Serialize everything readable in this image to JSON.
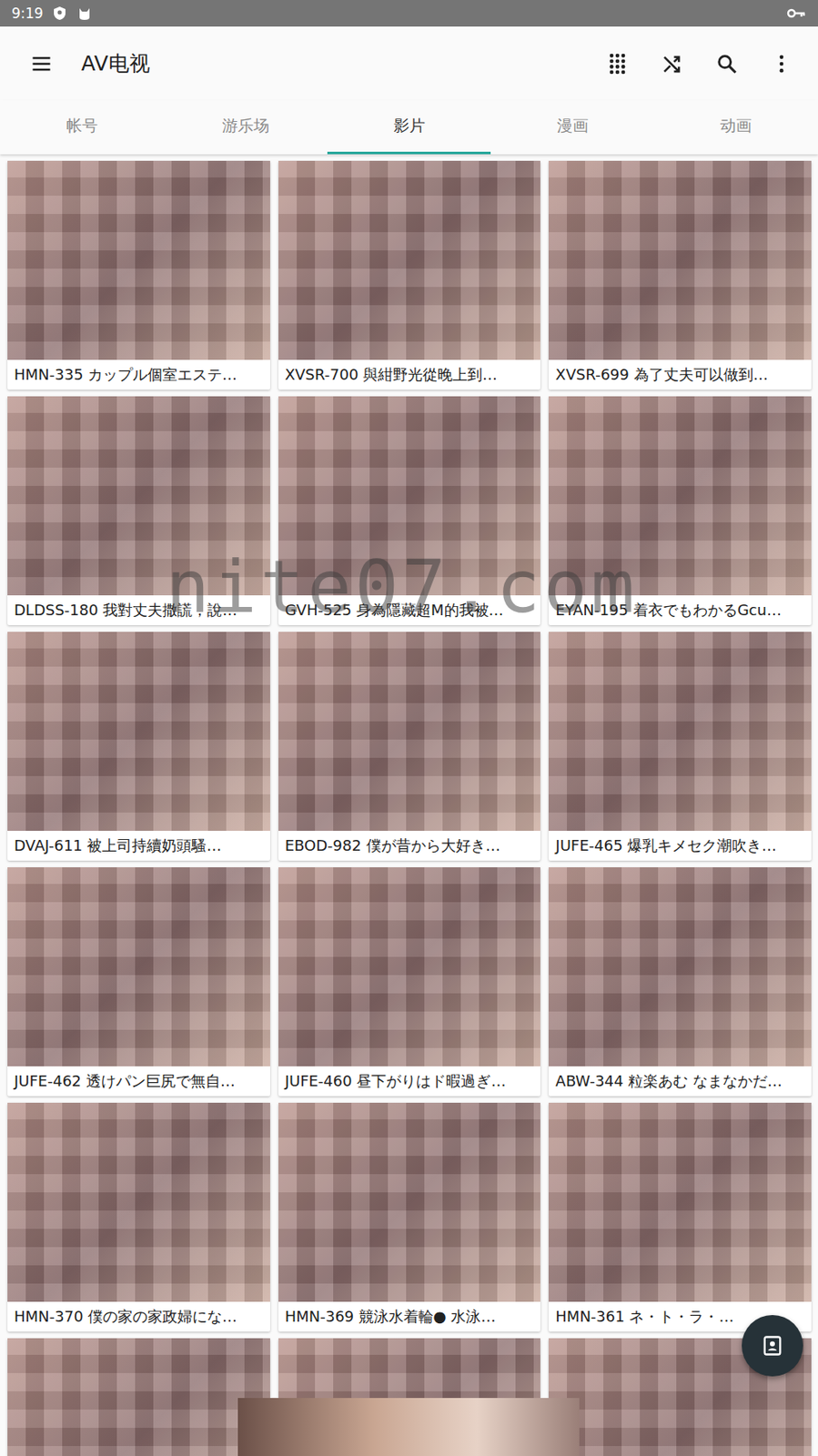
{
  "status_bar": {
    "time": "9:19"
  },
  "toolbar": {
    "title": "AV电视"
  },
  "tabs": [
    {
      "label": "帐号",
      "selected": false
    },
    {
      "label": "游乐场",
      "selected": false
    },
    {
      "label": "影片",
      "selected": true
    },
    {
      "label": "漫画",
      "selected": false
    },
    {
      "label": "动画",
      "selected": false
    }
  ],
  "videos": [
    {
      "title": "HMN-335 カップル個室エステ…"
    },
    {
      "title": "XVSR-700 與紺野光從晚上到…"
    },
    {
      "title": "XVSR-699 為了丈夫可以做到…"
    },
    {
      "title": "DLDSS-180 我對丈夫撒謊，說…"
    },
    {
      "title": "GVH-525 身為隱藏超M的我被…"
    },
    {
      "title": "EYAN-195 着衣でもわかるGcu…"
    },
    {
      "title": "DVAJ-611 被上司持續奶頭騷…"
    },
    {
      "title": "EBOD-982 僕が昔から大好き…"
    },
    {
      "title": "JUFE-465 爆乳キメセク潮吹き…"
    },
    {
      "title": "JUFE-462 透けパン巨尻で無自…"
    },
    {
      "title": "JUFE-460 昼下がりはド暇過ぎ…"
    },
    {
      "title": "ABW-344 粒楽あむ なまなかだ…"
    },
    {
      "title": "HMN-370 僕の家の家政婦にな…"
    },
    {
      "title": "HMN-369 競泳水着輪● 水泳…"
    },
    {
      "title": "HMN-361 ネ・ト・ラ・…"
    },
    {
      "title": ""
    },
    {
      "title": ""
    },
    {
      "title": ""
    }
  ],
  "watermark": "nite07.com"
}
